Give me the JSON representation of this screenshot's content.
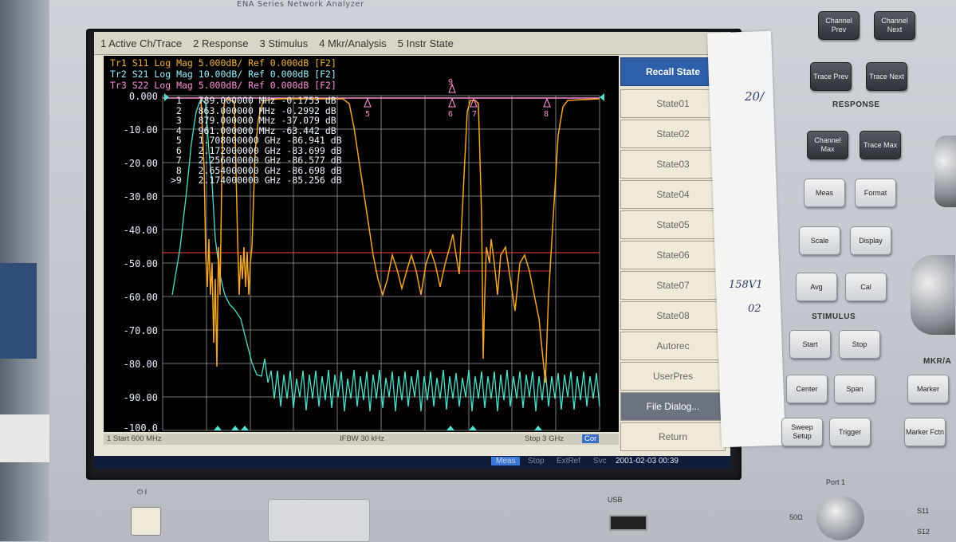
{
  "instrument": {
    "model_label": "ENA Series Network Analyzer"
  },
  "menu": [
    "1 Active Ch/Trace",
    "2 Response",
    "3 Stimulus",
    "4 Mkr/Analysis",
    "5 Instr State"
  ],
  "traces": [
    {
      "label": "Tr1 S11 Log Mag 5.000dB/ Ref 0.000dB [F2]",
      "color": "#f5b33a"
    },
    {
      "label": "Tr2 S21 Log Mag 10.00dB/ Ref 0.000dB [F2]",
      "color": "#9ef0ff"
    },
    {
      "label": "Tr3 S22 Log Mag 5.000dB/ Ref 0.000dB [F2]",
      "color": "#ff8fd8"
    }
  ],
  "y_axis": [
    "0.000",
    "-10.00",
    "-20.00",
    "-30.00",
    "-40.00",
    "-50.00",
    "-60.00",
    "-70.00",
    "-80.00",
    "-90.00",
    "-100.0"
  ],
  "markers": [
    " 1   789.000000 MHz -0.1753 dB",
    " 2   863.000000 MHz -0.2992 dB",
    " 3   879.000000 MHz -37.079 dB",
    " 4   961.000000 MHz -63.442 dB",
    " 5   1.708000000 GHz -86.941 dB",
    " 6   2.172000000 GHz -83.699 dB",
    " 7   2.256000000 GHz -86.577 dB",
    " 8   2.654000000 GHz -86.698 dB",
    ">9   2.174000000 GHz -85.256 dB"
  ],
  "status": {
    "start": "1  Start 600 MHz",
    "ifbw": "IFBW 30 kHz",
    "stop": "Stop 3 GHz",
    "cor": "Cor"
  },
  "bottombar": {
    "meas": "Meas",
    "stop": "Stop",
    "extref": "ExtRef",
    "svc": "Svc",
    "datetime": "2001-02-03 00:39"
  },
  "softkeys": {
    "title": "Recall State",
    "items": [
      "State01",
      "State02",
      "State03",
      "State04",
      "State05",
      "State06",
      "State07",
      "State08",
      "Autorec",
      "UserPres",
      "File Dialog...",
      "Return"
    ]
  },
  "hw_panel": {
    "buttons_top": [
      "Channel Prev",
      "Channel Next",
      "Trace Prev",
      "Trace Next"
    ],
    "response_label": "RESPONSE",
    "buttons_response": [
      "Channel Max",
      "Trace Max",
      "Meas",
      "Format",
      "Scale",
      "Display",
      "Avg",
      "Cal"
    ],
    "stimulus_label": "STIMULUS",
    "buttons_stimulus": [
      "Start",
      "Stop",
      "Center",
      "Span",
      "Sweep Setup",
      "Trigger"
    ],
    "mkr_label": "MKR/A",
    "buttons_mkr": [
      "Marker",
      "Marker Fctn"
    ]
  },
  "notes": [
    "20/",
    "158V1",
    "02"
  ],
  "front": {
    "port_label": "Port 1",
    "usb_label": "USB",
    "s11": "S11",
    "s12": "S12",
    "ohm": "50Ω"
  }
}
